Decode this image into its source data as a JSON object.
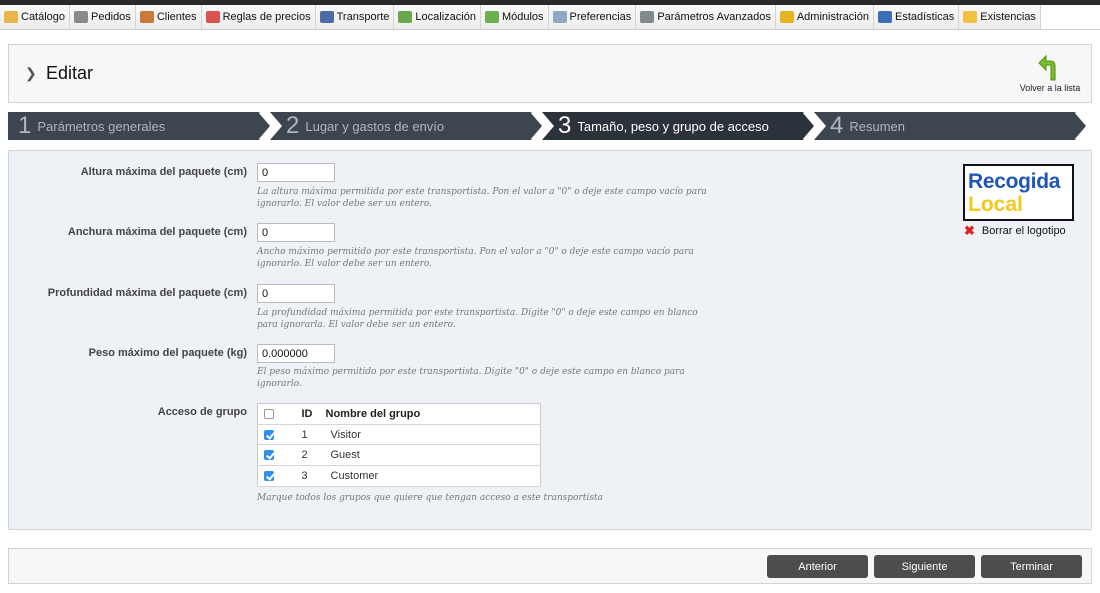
{
  "menu": [
    {
      "label": "Catálogo",
      "icon": "folder-icon",
      "color": "#e9b44c"
    },
    {
      "label": "Pedidos",
      "icon": "cart-icon",
      "color": "#8a8a8a"
    },
    {
      "label": "Clientes",
      "icon": "user-icon",
      "color": "#c87a3a"
    },
    {
      "label": "Reglas de precios",
      "icon": "price-tag-icon",
      "color": "#d9534f"
    },
    {
      "label": "Transporte",
      "icon": "truck-icon",
      "color": "#4a6da7"
    },
    {
      "label": "Localización",
      "icon": "globe-icon",
      "color": "#6aa84f"
    },
    {
      "label": "Módulos",
      "icon": "puzzle-icon",
      "color": "#6ab04c"
    },
    {
      "label": "Preferencias",
      "icon": "preferences-icon",
      "color": "#8fa8c8"
    },
    {
      "label": "Parámetros Avanzados",
      "icon": "wrench-icon",
      "color": "#7f8c8d"
    },
    {
      "label": "Administración",
      "icon": "key-icon",
      "color": "#e6b422"
    },
    {
      "label": "Estadísticas",
      "icon": "bar-chart-icon",
      "color": "#3d6fb6"
    },
    {
      "label": "Existencias",
      "icon": "stock-box-icon",
      "color": "#f0c040"
    }
  ],
  "header": {
    "title": "Editar",
    "back_label": "Volver a la lista"
  },
  "wizard": {
    "steps": [
      {
        "num": "1",
        "label": "Parámetros generales"
      },
      {
        "num": "2",
        "label": "Lugar y gastos de envío"
      },
      {
        "num": "3",
        "label": "Tamaño, peso y grupo de acceso"
      },
      {
        "num": "4",
        "label": "Resumen"
      }
    ],
    "active_step": 3,
    "bar_color": "#3c4550",
    "active_color": "#2b323b"
  },
  "form": {
    "max_height": {
      "label": "Altura máxima del paquete (cm)",
      "value": "0",
      "help": "La altura máxima permitida por este transportista. Pon el valor a \"0\" o deje este campo vacío para ignorarlo. El valor debe ser un entero."
    },
    "max_width": {
      "label": "Anchura máxima del paquete (cm)",
      "value": "0",
      "help": "Ancho máximo permitido por este transportista. Pon el valor a \"0\" o deje este campo vacío para ignorarlo. El valor debe ser un entero."
    },
    "max_depth": {
      "label": "Profundidad máxima del paquete (cm)",
      "value": "0",
      "help": "La profundidad máxima permitida por este transportista. Digite \"0\" o deje este campo en blanco para ignorarla. El valor debe ser un entero."
    },
    "max_weight": {
      "label": "Peso máximo del paquete (kg)",
      "value": "0.000000",
      "help": "El peso máximo permitido por este transportista. Digite \"0\" o deje este campo en blanco para ignorarlo."
    },
    "group_access": {
      "label": "Acceso de grupo",
      "header_id": "ID",
      "header_name": "Nombre del grupo",
      "rows": [
        {
          "id": "1",
          "name": "Visitor",
          "checked": true
        },
        {
          "id": "2",
          "name": "Guest",
          "checked": true
        },
        {
          "id": "3",
          "name": "Customer",
          "checked": true
        }
      ],
      "help": "Marque todos los grupos que quiere que tengan acceso a este transportista"
    }
  },
  "logo": {
    "line1": "Recogida",
    "line2": "Local",
    "delete_label": "Borrar el logotipo"
  },
  "footer": {
    "prev_label": "Anterior",
    "next_label": "Siguiente",
    "finish_label": "Terminar"
  }
}
